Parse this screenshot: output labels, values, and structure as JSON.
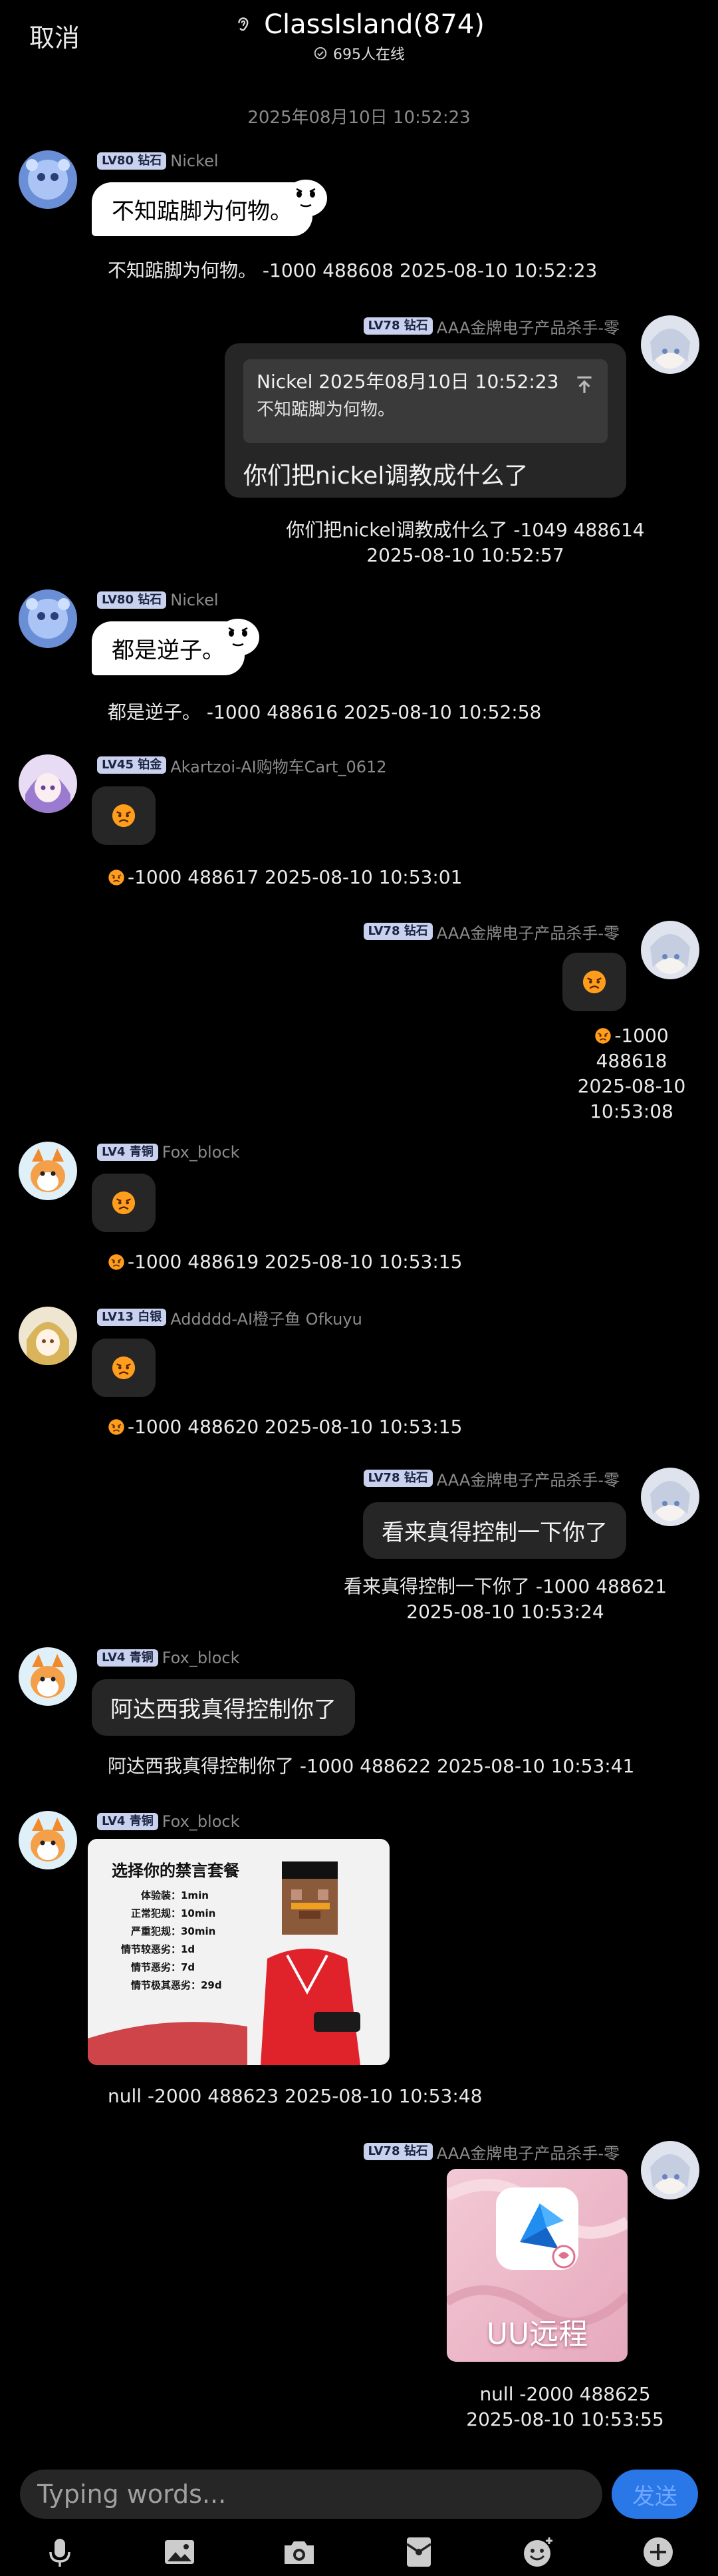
{
  "header": {
    "cancel_label": "取消",
    "group_name": "ClassIsland(874)",
    "online_text": "695人在线"
  },
  "time_divider": "2025年08月10日 10:52:23",
  "messages": [
    {
      "side": "left",
      "badge": "LV80 钻石",
      "nick": "Nickel",
      "bubble": "不知踮脚为何物。",
      "detail": "不知踮脚为何物。 -1000 488608   2025-08-10 10:52:23"
    },
    {
      "side": "right",
      "badge": "LV78 钻石",
      "nick": "AAA金牌电子产品杀手-零",
      "quote_header": "Nickel 2025年08月10日 10:52:23",
      "quote_text": "不知踮脚为何物。",
      "reply": "你们把nickel调教成什么了",
      "detail_line1": "你们把nickel调教成什么了 -1049 488614",
      "detail_line2": "2025-08-10 10:52:57"
    },
    {
      "side": "left",
      "badge": "LV80 钻石",
      "nick": "Nickel",
      "bubble": "都是逆子。",
      "detail": "都是逆子。 -1000 488616   2025-08-10 10:52:58"
    },
    {
      "side": "left",
      "badge": "LV45 铂金",
      "nick": "Akartzoi-AI购物车Cart_0612",
      "detail": "-1000 488617   2025-08-10 10:53:01"
    },
    {
      "side": "right",
      "badge": "LV78 钻石",
      "nick": "AAA金牌电子产品杀手-零",
      "detail_line1": "-1000",
      "detail_line2": "488618",
      "detail_line3": "2025-08-10",
      "detail_line4": "10:53:08"
    },
    {
      "side": "left",
      "badge": "LV4 青铜",
      "nick": "Fox_block",
      "detail": "-1000 488619   2025-08-10 10:53:15"
    },
    {
      "side": "left",
      "badge": "LV13 白银",
      "nick": "Addddd-AI橙子鱼 Ofkuyu",
      "detail": "-1000 488620   2025-08-10 10:53:15"
    },
    {
      "side": "right",
      "badge": "LV78 钻石",
      "nick": "AAA金牌电子产品杀手-零",
      "bubble": "看来真得控制一下你了",
      "detail_line1": "看来真得控制一下你了 -1000 488621",
      "detail_line2": "2025-08-10 10:53:24"
    },
    {
      "side": "left",
      "badge": "LV4 青铜",
      "nick": "Fox_block",
      "bubble": "阿达西我真得控制你了",
      "detail": "阿达西我真得控制你了 -1000 488622   2025-08-10 10:53:41"
    },
    {
      "side": "left",
      "badge": "LV4 青铜",
      "nick": "Fox_block",
      "image": {
        "title": "选择你的禁言套餐",
        "rows": [
          {
            "label": "体验装：",
            "value": "1min"
          },
          {
            "label": "正常犯规：",
            "value": "10min"
          },
          {
            "label": "严重犯规：",
            "value": "30min"
          },
          {
            "label": "情节较恶劣：",
            "value": "1d"
          },
          {
            "label": "情节恶劣：",
            "value": "7d"
          },
          {
            "label": "情节极其恶劣：",
            "value": "29d"
          }
        ]
      },
      "detail": "null -2000 488623   2025-08-10 10:53:48"
    },
    {
      "side": "right",
      "badge": "LV78 钻石",
      "nick": "AAA金牌电子产品杀手-零",
      "image_caption": "UU远程",
      "detail_line1": "null -2000 488625",
      "detail_line2": "2025-08-10 10:53:55"
    }
  ],
  "input": {
    "placeholder": "Typing words...",
    "send_label": "发送"
  },
  "toolbar": [
    "microphone-icon",
    "image-icon",
    "camera-icon",
    "red-packet-icon",
    "emoji-icon",
    "plus-icon"
  ],
  "colors": {
    "accent": "#2a77e8",
    "bubble": "#262626",
    "badge": "#c8d2ee",
    "background": "#000000"
  }
}
